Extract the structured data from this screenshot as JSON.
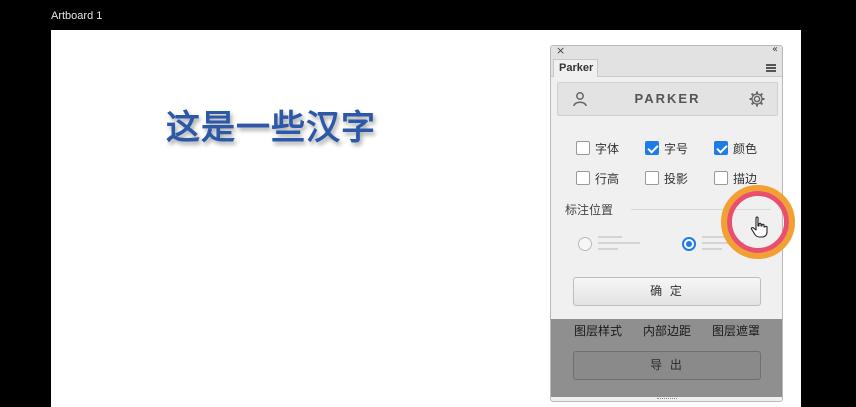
{
  "artboard": {
    "label": "Artboard 1",
    "headline": "这是一些汉字"
  },
  "panel": {
    "tab_label": "Parker",
    "close_glyph": "×",
    "collapse_glyph": "‹‹",
    "brand": "PARKER",
    "icons": {
      "user": "user-icon",
      "settings": "gear-icon",
      "menu": "menu-icon",
      "cursor": "hand-pointer-icon"
    },
    "options": [
      {
        "label": "字体",
        "checked": false
      },
      {
        "label": "字号",
        "checked": true
      },
      {
        "label": "颜色",
        "checked": true
      },
      {
        "label": "行高",
        "checked": false
      },
      {
        "label": "投影",
        "checked": false
      },
      {
        "label": "描边",
        "checked": false
      }
    ],
    "position_label": "标注位置",
    "position_choice": "right",
    "confirm_label": "确 定",
    "bottom_tabs": [
      "图层样式",
      "内部边距",
      "图层遮罩"
    ],
    "export_label": "导 出"
  },
  "colors": {
    "accent": "#1f7ce6",
    "headline": "#2d58a8",
    "ring_outer": "#f2a032",
    "ring_inner": "#e8506e"
  }
}
